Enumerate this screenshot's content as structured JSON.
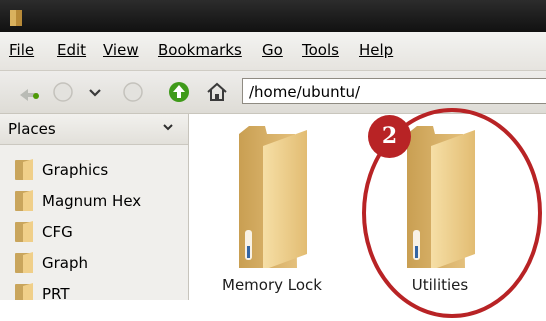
{
  "menu": {
    "file": "File",
    "edit": "Edit",
    "view": "View",
    "bookmarks": "Bookmarks",
    "go": "Go",
    "tools": "Tools",
    "help": "Help"
  },
  "toolbar": {
    "location_value": "/home/ubuntu/"
  },
  "sidebar": {
    "header": "Places",
    "items": [
      {
        "label": "Graphics"
      },
      {
        "label": "Magnum Hex"
      },
      {
        "label": "CFG"
      },
      {
        "label": "Graph"
      },
      {
        "label": "PRT"
      }
    ]
  },
  "content": {
    "items": [
      {
        "label": "Memory Lock"
      },
      {
        "label": "Utilities"
      }
    ]
  },
  "annotation": {
    "badge": "2",
    "color": "#b82325"
  },
  "icons": [
    "folder-icon",
    "back-icon",
    "forward-icon",
    "dropdown-icon",
    "stop-icon",
    "up-icon",
    "home-icon",
    "chevron-down-icon"
  ]
}
